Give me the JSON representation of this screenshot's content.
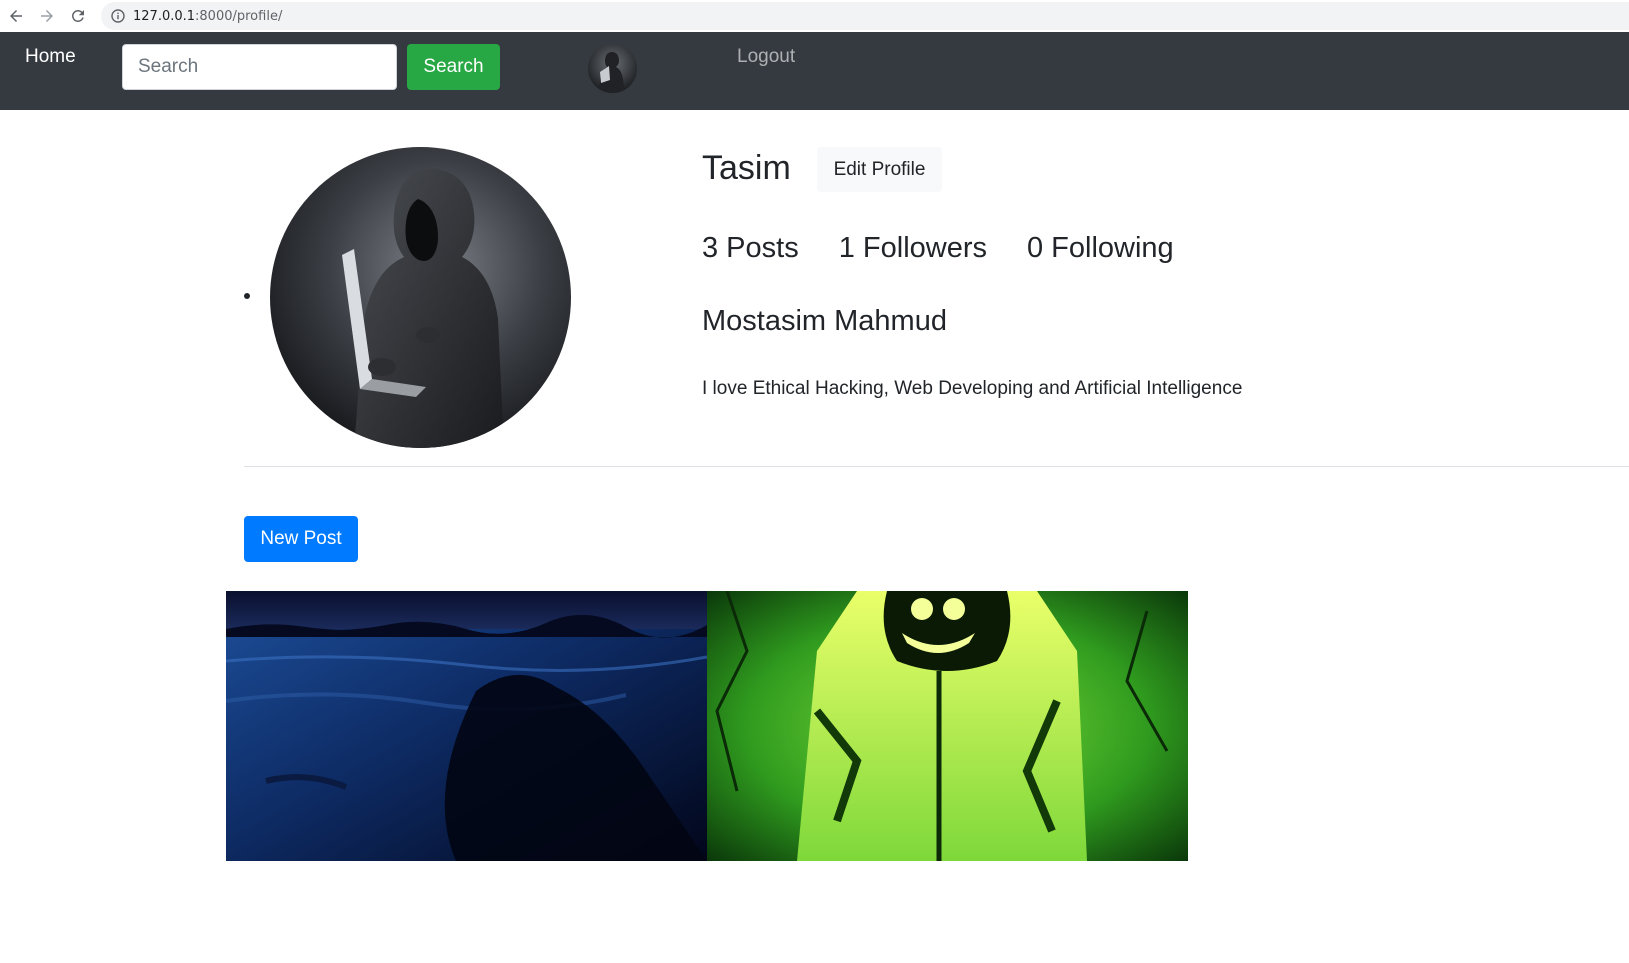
{
  "browser": {
    "url_host": "127.0.0.1",
    "url_rest": ":8000/profile/"
  },
  "navbar": {
    "home_label": "Home",
    "search_placeholder": "Search",
    "search_button_label": "Search",
    "logout_label": "Logout",
    "background_color": "#343a40"
  },
  "profile": {
    "username": "Tasim",
    "edit_button_label": "Edit Profile",
    "stats": {
      "posts": "3 Posts",
      "followers": "1 Followers",
      "following": "0 Following"
    },
    "full_name": "Mostasim Mahmud",
    "bio": "I love Ethical Hacking, Web Developing and Artificial Intelligence"
  },
  "actions": {
    "new_post_label": "New Post"
  },
  "posts": [
    {
      "image": "dark-blue-beach-image"
    },
    {
      "image": "green-hooded-figure-image"
    }
  ],
  "colors": {
    "success": "#28a745",
    "primary": "#007bff",
    "light": "#f8f9fa"
  }
}
